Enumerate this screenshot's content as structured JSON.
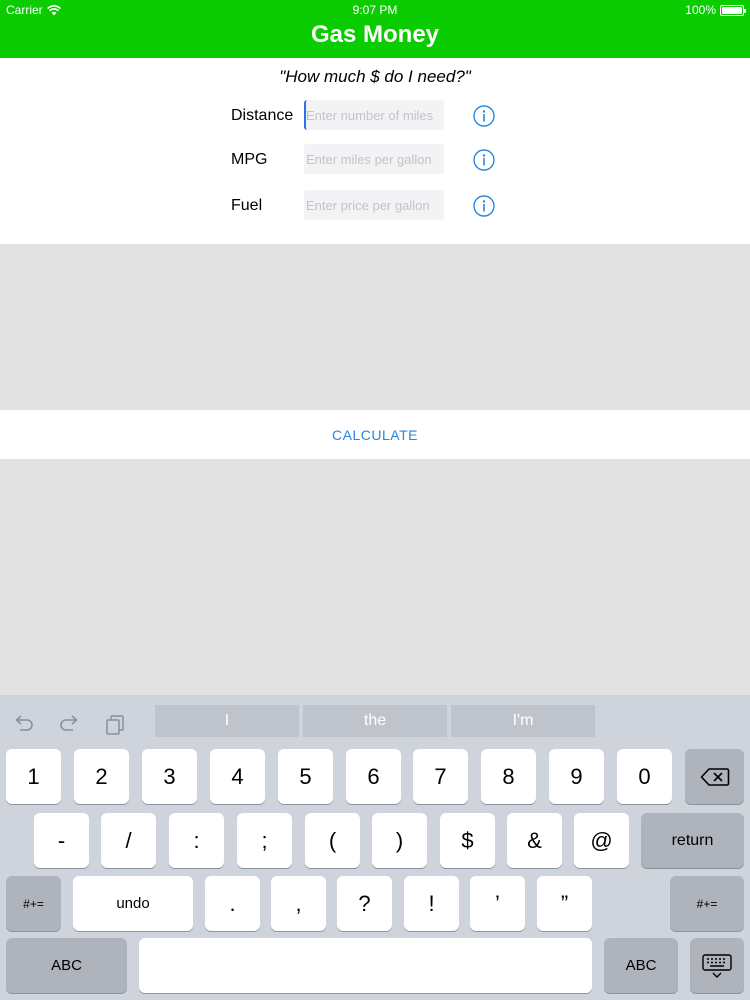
{
  "status_bar": {
    "carrier": "Carrier",
    "time": "9:07 PM",
    "battery": "100%"
  },
  "header": {
    "title": "Gas Money"
  },
  "form": {
    "question": "\"How much $ do I need?\"",
    "fields": [
      {
        "label": "Distance",
        "placeholder": "Enter number of miles"
      },
      {
        "label": "MPG",
        "placeholder": "Enter miles per gallon"
      },
      {
        "label": "Fuel",
        "placeholder": "Enter price per gallon"
      }
    ]
  },
  "calculate_label": "CALCULATE",
  "keyboard": {
    "suggestions": [
      "I",
      "the",
      "I'm"
    ],
    "row1": [
      "1",
      "2",
      "3",
      "4",
      "5",
      "6",
      "7",
      "8",
      "9",
      "0"
    ],
    "row2": [
      "-",
      "/",
      ":",
      ";",
      "(",
      ")",
      "$",
      "&",
      "@"
    ],
    "return_label": "return",
    "row3_left": "#+=",
    "undo_label": "undo",
    "row3": [
      ".",
      ",",
      "?",
      "!",
      "’",
      "”"
    ],
    "row3_right": "#+=",
    "abc_left": "ABC",
    "abc_right": "ABC"
  }
}
